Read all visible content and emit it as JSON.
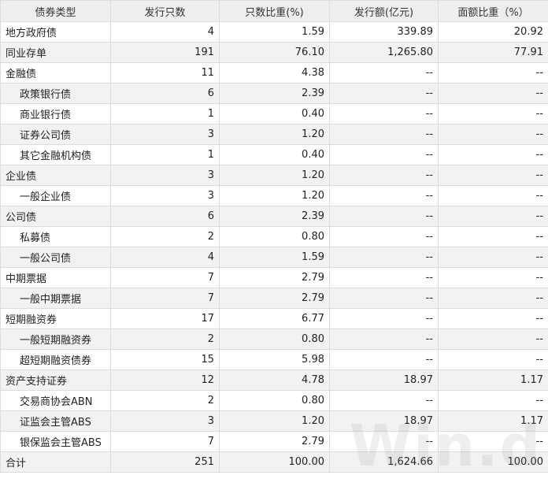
{
  "table": {
    "headers": [
      "债券类型",
      "发行只数",
      "只数比重(%)",
      "发行额(亿元)",
      "面额比重（%）"
    ],
    "rows": [
      {
        "level": 0,
        "cells": [
          "地方政府债",
          "4",
          "1.59",
          "339.89",
          "20.92"
        ]
      },
      {
        "level": 0,
        "cells": [
          "同业存单",
          "191",
          "76.10",
          "1,265.80",
          "77.91"
        ]
      },
      {
        "level": 0,
        "cells": [
          "金融债",
          "11",
          "4.38",
          "--",
          "--"
        ]
      },
      {
        "level": 1,
        "cells": [
          "政策银行债",
          "6",
          "2.39",
          "--",
          "--"
        ]
      },
      {
        "level": 1,
        "cells": [
          "商业银行债",
          "1",
          "0.40",
          "--",
          "--"
        ]
      },
      {
        "level": 1,
        "cells": [
          "证券公司债",
          "3",
          "1.20",
          "--",
          "--"
        ]
      },
      {
        "level": 1,
        "cells": [
          "其它金融机构债",
          "1",
          "0.40",
          "--",
          "--"
        ]
      },
      {
        "level": 0,
        "cells": [
          "企业债",
          "3",
          "1.20",
          "--",
          "--"
        ]
      },
      {
        "level": 1,
        "cells": [
          "一般企业债",
          "3",
          "1.20",
          "--",
          "--"
        ]
      },
      {
        "level": 0,
        "cells": [
          "公司债",
          "6",
          "2.39",
          "--",
          "--"
        ]
      },
      {
        "level": 1,
        "cells": [
          "私募债",
          "2",
          "0.80",
          "--",
          "--"
        ]
      },
      {
        "level": 1,
        "cells": [
          "一般公司债",
          "4",
          "1.59",
          "--",
          "--"
        ]
      },
      {
        "level": 0,
        "cells": [
          "中期票据",
          "7",
          "2.79",
          "--",
          "--"
        ]
      },
      {
        "level": 1,
        "cells": [
          "一般中期票据",
          "7",
          "2.79",
          "--",
          "--"
        ]
      },
      {
        "level": 0,
        "cells": [
          "短期融资券",
          "17",
          "6.77",
          "--",
          "--"
        ]
      },
      {
        "level": 1,
        "cells": [
          "一般短期融资券",
          "2",
          "0.80",
          "--",
          "--"
        ]
      },
      {
        "level": 1,
        "cells": [
          "超短期融资债券",
          "15",
          "5.98",
          "--",
          "--"
        ]
      },
      {
        "level": 0,
        "cells": [
          "资产支持证券",
          "12",
          "4.78",
          "18.97",
          "1.17"
        ]
      },
      {
        "level": 1,
        "cells": [
          "交易商协会ABN",
          "2",
          "0.80",
          "--",
          "--"
        ]
      },
      {
        "level": 1,
        "cells": [
          "证监会主管ABS",
          "3",
          "1.20",
          "18.97",
          "1.17"
        ]
      },
      {
        "level": 1,
        "cells": [
          "银保监会主管ABS",
          "7",
          "2.79",
          "--",
          "--"
        ]
      },
      {
        "level": 0,
        "cells": [
          "合计",
          "251",
          "100.00",
          "1,624.66",
          "100.00"
        ]
      }
    ]
  },
  "watermark": "Win.d"
}
